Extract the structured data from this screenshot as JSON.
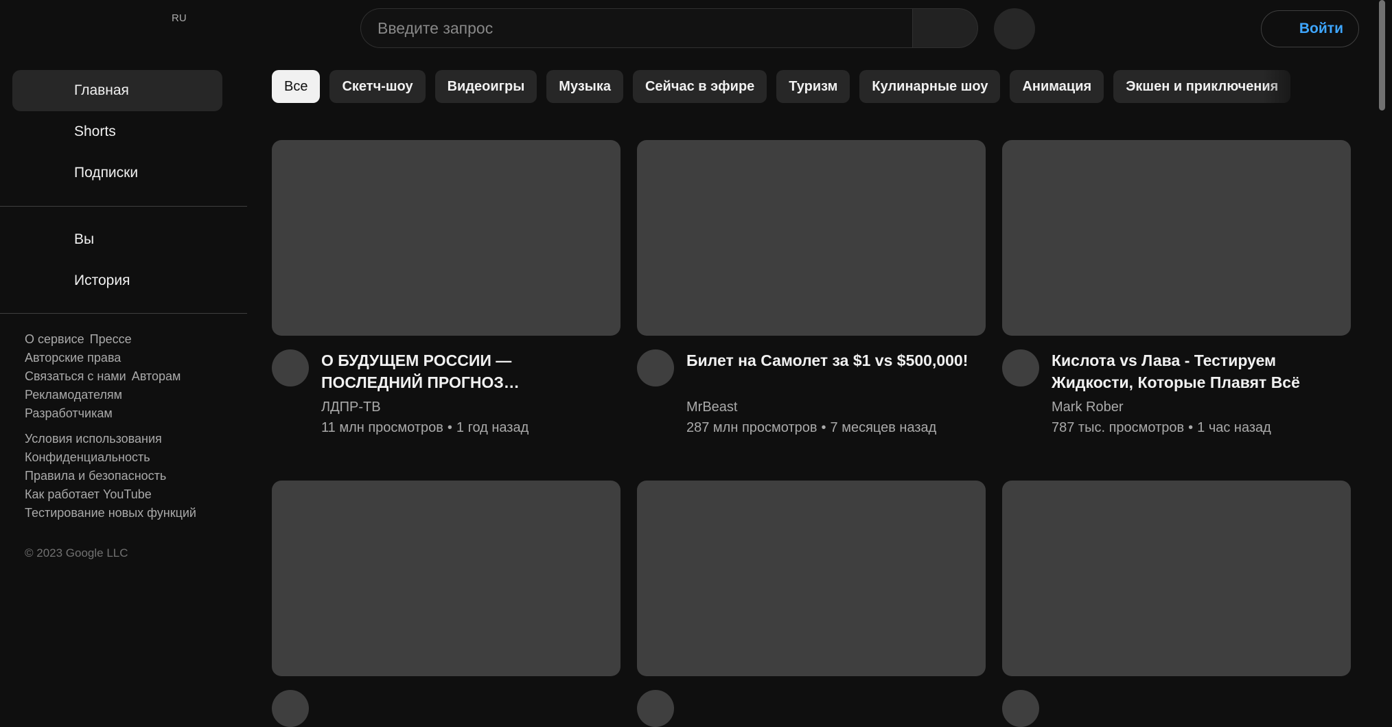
{
  "topbar": {
    "region": "RU",
    "search_placeholder": "Введите запрос",
    "signin_label": "Войти"
  },
  "sidebar": {
    "primary": [
      {
        "label": "Главная",
        "icon": "home-icon",
        "active": true
      },
      {
        "label": "Shorts",
        "icon": "shorts-icon",
        "active": false
      },
      {
        "label": "Подписки",
        "icon": "subscriptions-icon",
        "active": false
      }
    ],
    "secondary": [
      {
        "label": "Вы",
        "icon": "you-icon"
      },
      {
        "label": "История",
        "icon": "history-icon"
      }
    ],
    "footer_primary": {
      "about": "О сервисе",
      "press": "Прессе",
      "copyright": "Авторские права",
      "contact": "Связаться с нами",
      "creators": "Авторам",
      "advertise": "Рекламодателям",
      "developers": "Разработчикам"
    },
    "footer_secondary": {
      "terms": "Условия использования",
      "privacy": "Конфиденциальность",
      "policy": "Правила и безопасность",
      "how_works": "Как работает YouTube",
      "test_features": "Тестирование новых функций"
    },
    "copyright_line": "© 2023 Google LLC"
  },
  "chips": [
    "Все",
    "Скетч-шоу",
    "Видеоигры",
    "Музыка",
    "Сейчас в эфире",
    "Туризм",
    "Кулинарные шоу",
    "Анимация",
    "Экшен и приключения"
  ],
  "videos": [
    {
      "title": "О БУДУЩЕМ РОССИИ — ПОСЛЕДНИЙ ПРОГНОЗ…",
      "channel": "ЛДПР-ТВ",
      "views": "11 млн просмотров",
      "age": "1 год назад"
    },
    {
      "title": "Билет на Самолет за $1 vs $500,000!",
      "channel": "MrBeast",
      "views": "287 млн просмотров",
      "age": "7 месяцев назад"
    },
    {
      "title": "Кислота vs Лава - Тестируем Жидкости, Которые Плавят Всё",
      "channel": "Mark Rober",
      "views": "787 тыс. просмотров",
      "age": "1 час назад"
    }
  ],
  "meta_separator": "•",
  "colors": {
    "background": "#0f0f0f",
    "surface": "#272727",
    "placeholder": "#3f3f3f",
    "accent": "#3ea6ff",
    "text_secondary": "#aaaaaa"
  }
}
